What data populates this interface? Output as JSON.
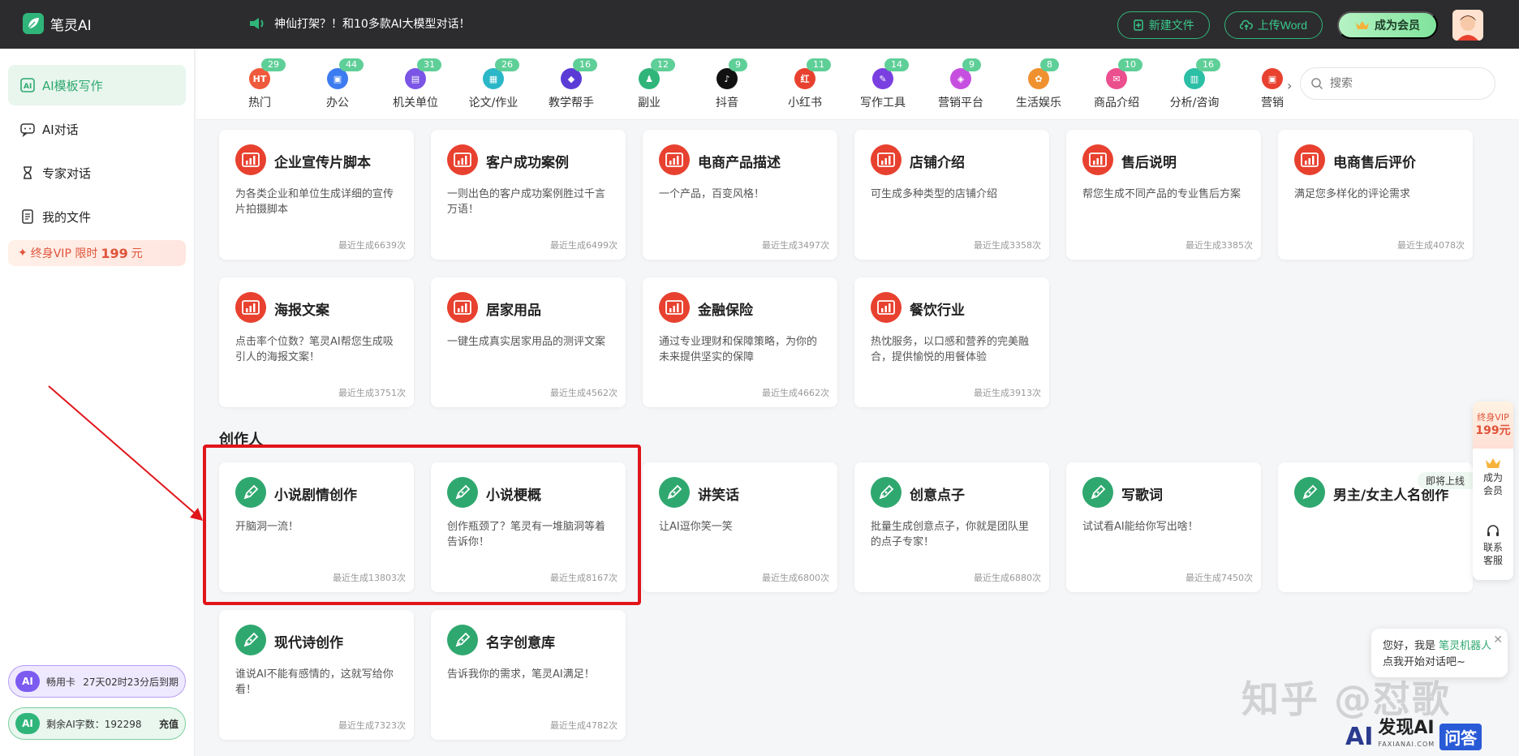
{
  "app": {
    "name": "笔灵AI"
  },
  "announcement": "神仙打架？！和10多款AI大模型对话！",
  "header": {
    "new_file": "新建文件",
    "upload_word": "上传Word",
    "become_member": "成为会员"
  },
  "sidebar": {
    "items": [
      {
        "label": "AI模板写作",
        "icon": "ai-template-icon",
        "active": true
      },
      {
        "label": "AI对话",
        "icon": "chat-icon",
        "active": false
      },
      {
        "label": "专家对话",
        "icon": "expert-icon",
        "active": false
      },
      {
        "label": "我的文件",
        "icon": "file-icon",
        "active": false
      }
    ],
    "vip": {
      "prefix": "终身VIP 限时",
      "price": "199",
      "unit": "元"
    },
    "pass_card": {
      "badge": "AI",
      "name": "畅用卡",
      "expiry": "27天02时23分后到期"
    },
    "words": {
      "badge": "AI",
      "label": "剩余AI字数：192298",
      "action": "充值"
    }
  },
  "tabs": [
    {
      "label": "热门",
      "count": "29",
      "color": "#f05a3c",
      "glyph": "HT"
    },
    {
      "label": "办公",
      "count": "44",
      "color": "#3d7bf0",
      "glyph": "▣"
    },
    {
      "label": "机关单位",
      "count": "31",
      "color": "#7a55e6",
      "glyph": "▤"
    },
    {
      "label": "论文/作业",
      "count": "26",
      "color": "#2bb7c8",
      "glyph": "▦"
    },
    {
      "label": "教学帮手",
      "count": "16",
      "color": "#5b3bd6",
      "glyph": "◆"
    },
    {
      "label": "副业",
      "count": "12",
      "color": "#2fb57a",
      "glyph": "♟"
    },
    {
      "label": "抖音",
      "count": "9",
      "color": "#111111",
      "glyph": "♪"
    },
    {
      "label": "小红书",
      "count": "11",
      "color": "#e8412f",
      "glyph": "红"
    },
    {
      "label": "写作工具",
      "count": "14",
      "color": "#7a3fe0",
      "glyph": "✎"
    },
    {
      "label": "营销平台",
      "count": "9",
      "color": "#c64fe0",
      "glyph": "◈"
    },
    {
      "label": "生活娱乐",
      "count": "8",
      "color": "#f0912f",
      "glyph": "✿"
    },
    {
      "label": "商品介绍",
      "count": "10",
      "color": "#ec4f8e",
      "glyph": "✉"
    },
    {
      "label": "分析/咨询",
      "count": "16",
      "color": "#2bbfa6",
      "glyph": "▥"
    },
    {
      "label": "营销",
      "count": "",
      "color": "#e8412f",
      "glyph": "▣"
    }
  ],
  "search": {
    "placeholder": "搜索"
  },
  "section_creator": "创作人",
  "cards_row1": [
    {
      "title": "企业宣传片脚本",
      "desc": "为各类企业和单位生成详细的宣传片拍摄脚本",
      "count": "最近生成6639次"
    },
    {
      "title": "客户成功案例",
      "desc": "一则出色的客户成功案例胜过千言万语！",
      "count": "最近生成6499次"
    },
    {
      "title": "电商产品描述",
      "desc": "一个产品，百变风格！",
      "count": "最近生成3497次"
    },
    {
      "title": "店铺介绍",
      "desc": "可生成多种类型的店铺介绍",
      "count": "最近生成3358次"
    },
    {
      "title": "售后说明",
      "desc": "帮您生成不同产品的专业售后方案",
      "count": "最近生成3385次"
    },
    {
      "title": "电商售后评价",
      "desc": "满足您多样化的评论需求",
      "count": "最近生成4078次"
    }
  ],
  "cards_row2": [
    {
      "title": "海报文案",
      "desc": "点击率个位数？笔灵AI帮您生成吸引人的海报文案！",
      "count": "最近生成3751次"
    },
    {
      "title": "居家用品",
      "desc": "一键生成真实居家用品的测评文案",
      "count": "最近生成4562次"
    },
    {
      "title": "金融保险",
      "desc": "通过专业理财和保障策略，为你的未来提供坚实的保障",
      "count": "最近生成4662次"
    },
    {
      "title": "餐饮行业",
      "desc": "热忱服务，以口感和营养的完美融合，提供愉悦的用餐体验",
      "count": "最近生成3913次"
    }
  ],
  "cards_row3": [
    {
      "title": "小说剧情创作",
      "desc": "开脑洞一流！",
      "count": "最近生成13803次"
    },
    {
      "title": "小说梗概",
      "desc": "创作瓶颈了？笔灵有一堆脑洞等着告诉你！",
      "count": "最近生成8167次"
    },
    {
      "title": "讲笑话",
      "desc": "让AI逗你笑一笑",
      "count": "最近生成6800次"
    },
    {
      "title": "创意点子",
      "desc": "批量生成创意点子，你就是团队里的点子专家！",
      "count": "最近生成6880次"
    },
    {
      "title": "写歌词",
      "desc": "试试看AI能给你写出啥！",
      "count": "最近生成7450次"
    },
    {
      "title": "男主/女主人名创作",
      "desc": "",
      "count": "",
      "tag": "即将上线"
    }
  ],
  "cards_row4": [
    {
      "title": "现代诗创作",
      "desc": "谁说AI不能有感情的，这就写给你看！",
      "count": "最近生成7323次"
    },
    {
      "title": "名字创意库",
      "desc": "告诉我你的需求，笔灵AI满足！",
      "count": "最近生成4782次"
    }
  ],
  "float_bar": {
    "vip_label": "终身VIP",
    "vip_price": "199元",
    "member": "成为会员",
    "service": "联系客服"
  },
  "chat": {
    "greeting_prefix": "您好，我是",
    "bot_name": "笔灵机器人",
    "line2": "点我开始对话吧~"
  },
  "watermark": "知乎 @怼歌",
  "brand": {
    "ai": "AI",
    "name": "发现AI",
    "sub": "FAXIANAI.COM",
    "qa": "问答"
  },
  "colors": {
    "accent": "#2fb57a",
    "red_icon": "#e8412f",
    "highlight": "#e0161b",
    "topbar": "#2c2c2e"
  }
}
